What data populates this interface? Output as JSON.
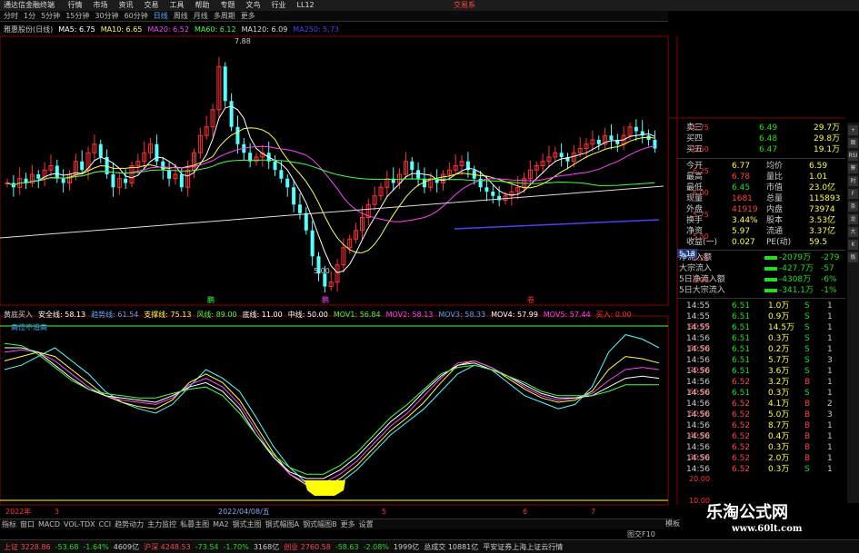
{
  "window": {
    "title": "通达信金融终端",
    "menus": [
      "行情",
      "市场",
      "资讯",
      "交易",
      "工具",
      "帮助",
      "专题",
      "文鸟",
      "行业",
      "LL12"
    ],
    "brand": "交易系"
  },
  "toolbar": {
    "items": [
      "分时",
      "1分",
      "5分钟",
      "15分钟",
      "30分钟",
      "60分钟",
      "日线",
      "周线",
      "月线",
      "多周期",
      "更多"
    ],
    "active": "日线"
  },
  "ma_line": {
    "stock": "雅惠股份(日线)",
    "items": [
      {
        "label": "MA5: 6.75",
        "color": "#ffffff"
      },
      {
        "label": "MA10: 6.65",
        "color": "#ffff44"
      },
      {
        "label": "MA20: 6.52",
        "color": "#ff44ff"
      },
      {
        "label": "MA60: 6.12",
        "color": "#44ff44"
      },
      {
        "label": "MA120: 6.09",
        "color": "#dddddd"
      },
      {
        "label": "MA250: 5.73",
        "color": "#4444ff"
      }
    ]
  },
  "price_chart": {
    "high_label": "7.88",
    "low_label": "5.00",
    "markers": [
      "鹏",
      "鹏",
      "卷"
    ],
    "price_ticks": [
      "6.75",
      "6.50",
      "6.25",
      "6.00",
      "5.75",
      "5.50",
      "5.25",
      "5.00"
    ],
    "current_price_tag": "5.18"
  },
  "indicator": {
    "name": "黄底买入",
    "items": [
      {
        "label": "安全线: 58.13",
        "color": "#ffffff"
      },
      {
        "label": "趋势线: 61.54",
        "color": "#4fa8ff"
      },
      {
        "label": "支撑线: 75.13",
        "color": "#ffff44"
      },
      {
        "label": "风线: 89.00",
        "color": "#44ff44"
      },
      {
        "label": "底线: 11.00",
        "color": "#ffffff"
      },
      {
        "label": "中线: 50.00",
        "color": "#ffffff"
      },
      {
        "label": "MOV1: 56.84",
        "color": "#44ff44"
      },
      {
        "label": "MOV2: 58.13",
        "color": "#ff44ff"
      },
      {
        "label": "MOV3: 58.33",
        "color": "#44aaff"
      },
      {
        "label": "MOV4: 57.99",
        "color": "#ffffff"
      },
      {
        "label": "MOV5: 57.44",
        "color": "#ff44ff"
      },
      {
        "label": "买入: 0.00",
        "color": "#ff3333"
      }
    ],
    "legend_note": "高位不追高",
    "ticks": [
      "90.00",
      "80.00",
      "70.00",
      "60.00",
      "50.00",
      "40.00",
      "30.00",
      "20.00",
      "10.00"
    ]
  },
  "time_axis": {
    "labels": [
      "2022年",
      "3",
      "2022/04/08/五",
      "5",
      "6",
      "7"
    ]
  },
  "bottom_tabs": [
    "指标",
    "窗口",
    "MACD",
    "VOL-TDX",
    "CCI",
    "趋势动力",
    "主力监控",
    "私募主图",
    "MA2",
    "钢式主图",
    "钢式幅图A",
    "钢式幅图B",
    "更多",
    "设置"
  ],
  "bottom_tabs_right": "图交F10",
  "bottom_tabs_far": "模板",
  "quote_panel": {
    "asks": [
      {
        "label": "卖三",
        "price": "6.49",
        "vol": "29.7万"
      },
      {
        "label": "买四",
        "price": "6.48",
        "vol": "29.8万"
      },
      {
        "label": "买五",
        "price": "6.47",
        "vol": "19.1万"
      }
    ],
    "stats": [
      {
        "l1": "今开",
        "v1": "6.77",
        "l2": "均价",
        "v2": "6.59"
      },
      {
        "l1": "最高",
        "v1": "6.78",
        "l2": "量比",
        "v2": "1.01"
      },
      {
        "l1": "最低",
        "v1": "6.45",
        "l2": "市值",
        "v2": "23.0亿"
      },
      {
        "l1": "现量",
        "v1": "1681",
        "l2": "总量",
        "v2": "115893"
      },
      {
        "l1": "外盘",
        "v1": "41919",
        "l2": "内盘",
        "v2": "73974"
      },
      {
        "l1": "换手",
        "v1": "3.44%",
        "l2": "股本",
        "v2": "3.53亿"
      },
      {
        "l1": "净资",
        "v1": "5.97",
        "l2": "流通",
        "v2": "3.37亿"
      },
      {
        "l1": "收益(一)",
        "v1": "0.027",
        "l2": "PE(动)",
        "v2": "59.5"
      }
    ],
    "flows": [
      {
        "label": "净流入额",
        "value": "-2079万",
        "right": "-279"
      },
      {
        "label": "大宗流入",
        "value": "-427.7万",
        "right": "-57"
      },
      {
        "label": "5日净流入额",
        "value": "-4308万",
        "right": "-6%"
      },
      {
        "label": "5日大宗流入",
        "value": "-341.1万",
        "right": "-1%"
      }
    ],
    "ticks": [
      [
        "14:55",
        "6.51",
        "1.0万",
        "S",
        "1"
      ],
      [
        "14:55",
        "6.51",
        "0.9万",
        "S",
        "1"
      ],
      [
        "14:55",
        "6.51",
        "14.5万",
        "S",
        "1"
      ],
      [
        "14:56",
        "6.51",
        "0.3万",
        "S",
        "1"
      ],
      [
        "14:56",
        "6.51",
        "0.2万",
        "S",
        "1"
      ],
      [
        "14:56",
        "6.51",
        "5.7万",
        "S",
        "3"
      ],
      [
        "14:56",
        "6.51",
        "3.6万",
        "S",
        "1"
      ],
      [
        "14:56",
        "6.52",
        "3.2万",
        "B",
        "1"
      ],
      [
        "14:56",
        "6.51",
        "0.3万",
        "S",
        "1"
      ],
      [
        "14:56",
        "6.52",
        "4.1万",
        "B",
        "2"
      ],
      [
        "14:56",
        "6.52",
        "5.0万",
        "B",
        "3"
      ],
      [
        "14:56",
        "6.52",
        "8.7万",
        "B",
        "1"
      ],
      [
        "14:56",
        "6.52",
        "0.4万",
        "B",
        "1"
      ],
      [
        "14:56",
        "6.52",
        "0.3万",
        "B",
        "1"
      ],
      [
        "14:56",
        "6.52",
        "2.0万",
        "B",
        "1"
      ],
      [
        "14:56",
        "6.52",
        "0.3万",
        "S",
        "1"
      ]
    ]
  },
  "status_bar": {
    "items": [
      {
        "text": "上证 3228.86",
        "cls": "up"
      },
      {
        "text": "-53.68",
        "cls": "dn"
      },
      {
        "text": "-1.64%",
        "cls": "dn"
      },
      {
        "text": "4609亿",
        "cls": ""
      },
      {
        "text": "沪深 4248.53",
        "cls": "up"
      },
      {
        "text": "-73.54",
        "cls": "dn"
      },
      {
        "text": "-1.70%",
        "cls": "dn"
      },
      {
        "text": "3168亿",
        "cls": ""
      },
      {
        "text": "创业 2760.58",
        "cls": "up"
      },
      {
        "text": "-58.63",
        "cls": "dn"
      },
      {
        "text": "-2.08%",
        "cls": "dn"
      },
      {
        "text": "1999亿",
        "cls": ""
      },
      {
        "text": "总成交 10881亿",
        "cls": ""
      },
      {
        "text": "平安证券上海上证云行情",
        "cls": ""
      }
    ]
  },
  "watermark": {
    "line1": "乐淘公式网",
    "line2": "www.60lt.com"
  },
  "side_buttons": [
    "+",
    "图",
    "RSI",
    "筹",
    "时",
    "F",
    "条",
    "龙",
    "大",
    "K",
    "板"
  ]
}
